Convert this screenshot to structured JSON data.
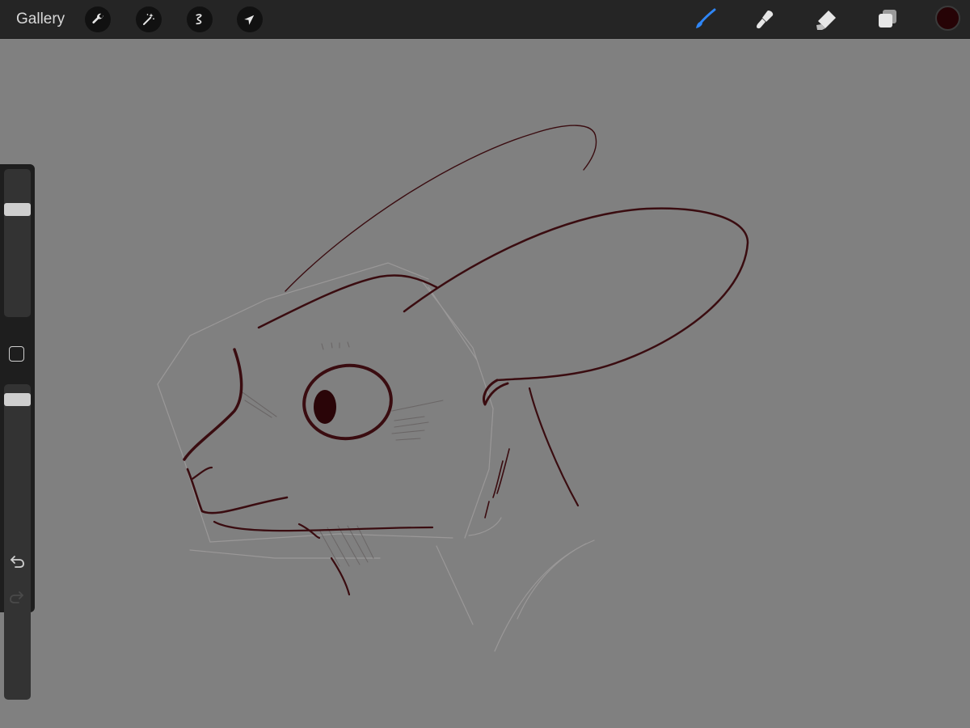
{
  "toolbar": {
    "gallery_label": "Gallery",
    "left_tools": [
      "wrench-icon",
      "magic-wand-icon",
      "selection-icon",
      "transform-arrow-icon"
    ],
    "right_tools": [
      "brush-icon",
      "smudge-icon",
      "eraser-icon",
      "layers-icon"
    ],
    "active_tool": "brush",
    "active_tool_color": "#2f86f6"
  },
  "current_color": "#260306",
  "canvas": {
    "background": "#808080",
    "ink_color": "#3a0c10",
    "sketch_color": "#9a9898"
  },
  "sidebar": {
    "brush_size_level": 0.75,
    "opacity_level": 0.97,
    "modify_button": "square-icon",
    "undo_icon": "undo-icon",
    "redo_icon": "redo-icon",
    "redo_enabled": false
  }
}
